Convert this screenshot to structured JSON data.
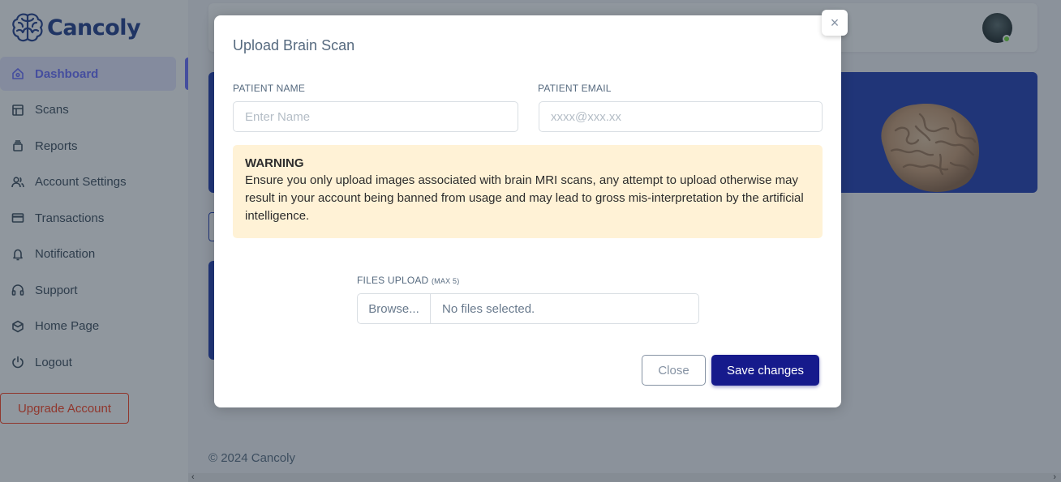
{
  "brand": {
    "name": "Cancoly"
  },
  "sidebar": {
    "items": [
      {
        "label": "Dashboard",
        "icon": "home-icon",
        "active": true
      },
      {
        "label": "Scans",
        "icon": "layout-icon"
      },
      {
        "label": "Reports",
        "icon": "box-icon"
      },
      {
        "label": "Account Settings",
        "icon": "users-icon"
      },
      {
        "label": "Transactions",
        "icon": "credit-card-icon"
      },
      {
        "label": "Notification",
        "icon": "bell-icon"
      },
      {
        "label": "Support",
        "icon": "headphones-icon"
      },
      {
        "label": "Home Page",
        "icon": "cube-icon"
      },
      {
        "label": "Logout",
        "icon": "power-icon"
      }
    ],
    "upgrade_label": "Upgrade Account"
  },
  "footer": {
    "text": "© 2024 Cancoly"
  },
  "modal": {
    "title": "Upload Brain Scan",
    "close_icon": "×",
    "patient_name": {
      "label": "PATIENT NAME",
      "placeholder": "Enter Name",
      "value": ""
    },
    "patient_email": {
      "label": "PATIENT EMAIL",
      "placeholder": "xxxx@xxx.xx",
      "value": ""
    },
    "warning": {
      "title": "WARNING",
      "text": "Ensure you only upload images associated with brain MRI scans, any attempt to upload otherwise may result in your account being banned from usage and may lead to gross mis-interpretation by the artificial intelligence."
    },
    "files": {
      "label": "FILES UPLOAD",
      "hint": "(MAX 5)",
      "browse_label": "Browse...",
      "status": "No files selected."
    },
    "close_label": "Close",
    "save_label": "Save changes"
  },
  "colors": {
    "primary": "#696cff",
    "brand": "#1e3a8a",
    "banner": "#1e3bb3",
    "save_button": "#161a8c",
    "warning_bg": "#fff2d6",
    "danger": "#ff3e1d"
  }
}
